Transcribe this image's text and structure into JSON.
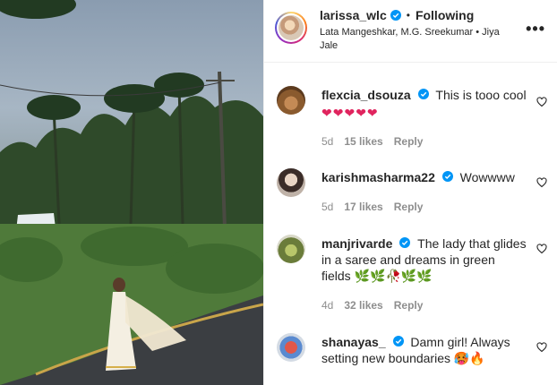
{
  "post": {
    "username": "larissa_wlc",
    "separator": "•",
    "follow_status": "Following",
    "audio": "Lata Mangeshkar, M.G. Sreekumar • Jiya Jale",
    "more_label": "•••"
  },
  "comments": [
    {
      "username": "flexcia_dsouza",
      "text": "This is tooo cool",
      "extra": "❤❤❤❤❤",
      "age": "5d",
      "likes": "15 likes",
      "reply": "Reply"
    },
    {
      "username": "karishmasharma22",
      "text": "Wowwww",
      "age": "5d",
      "likes": "17 likes",
      "reply": "Reply"
    },
    {
      "username": "manjrivarde",
      "text": "The lady that glides in a saree and dreams in green fields",
      "extra": "🌿🌿🥀🌿🌿",
      "age": "4d",
      "likes": "32 likes",
      "reply": "Reply"
    },
    {
      "username": "shanayas_",
      "text": "Damn girl! Always setting new boundaries",
      "extra": "🥵🔥",
      "age": "",
      "likes": "",
      "reply": ""
    }
  ],
  "colors": {
    "verified": "#0095f6",
    "text": "#262626",
    "muted": "#8e8e8e"
  },
  "icons": {
    "verified": "verified-badge-icon",
    "like": "heart-outline-icon",
    "more": "more-horizontal-icon"
  }
}
